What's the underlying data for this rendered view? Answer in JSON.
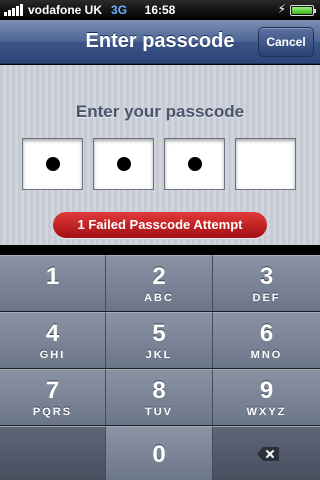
{
  "status_bar": {
    "carrier": "vodafone UK",
    "network": "3G",
    "time": "16:58"
  },
  "nav": {
    "title": "Enter passcode",
    "cancel_label": "Cancel"
  },
  "passcode": {
    "prompt": "Enter your passcode",
    "digits_entered": 3,
    "total_digits": 4,
    "failed_message": "1 Failed Passcode Attempt"
  },
  "keypad": {
    "keys": [
      {
        "num": "1",
        "letters": ""
      },
      {
        "num": "2",
        "letters": "ABC"
      },
      {
        "num": "3",
        "letters": "DEF"
      },
      {
        "num": "4",
        "letters": "GHI"
      },
      {
        "num": "5",
        "letters": "JKL"
      },
      {
        "num": "6",
        "letters": "MNO"
      },
      {
        "num": "7",
        "letters": "PQRS"
      },
      {
        "num": "8",
        "letters": "TUV"
      },
      {
        "num": "9",
        "letters": "WXYZ"
      },
      {
        "num": "0",
        "letters": ""
      }
    ]
  },
  "colors": {
    "nav_blue": "#3b5486",
    "fail_red": "#c41e21",
    "keypad_gray": "#7a8497"
  },
  "icons": [
    "signal-icon",
    "battery-icon",
    "charging-icon",
    "backspace-icon"
  ]
}
